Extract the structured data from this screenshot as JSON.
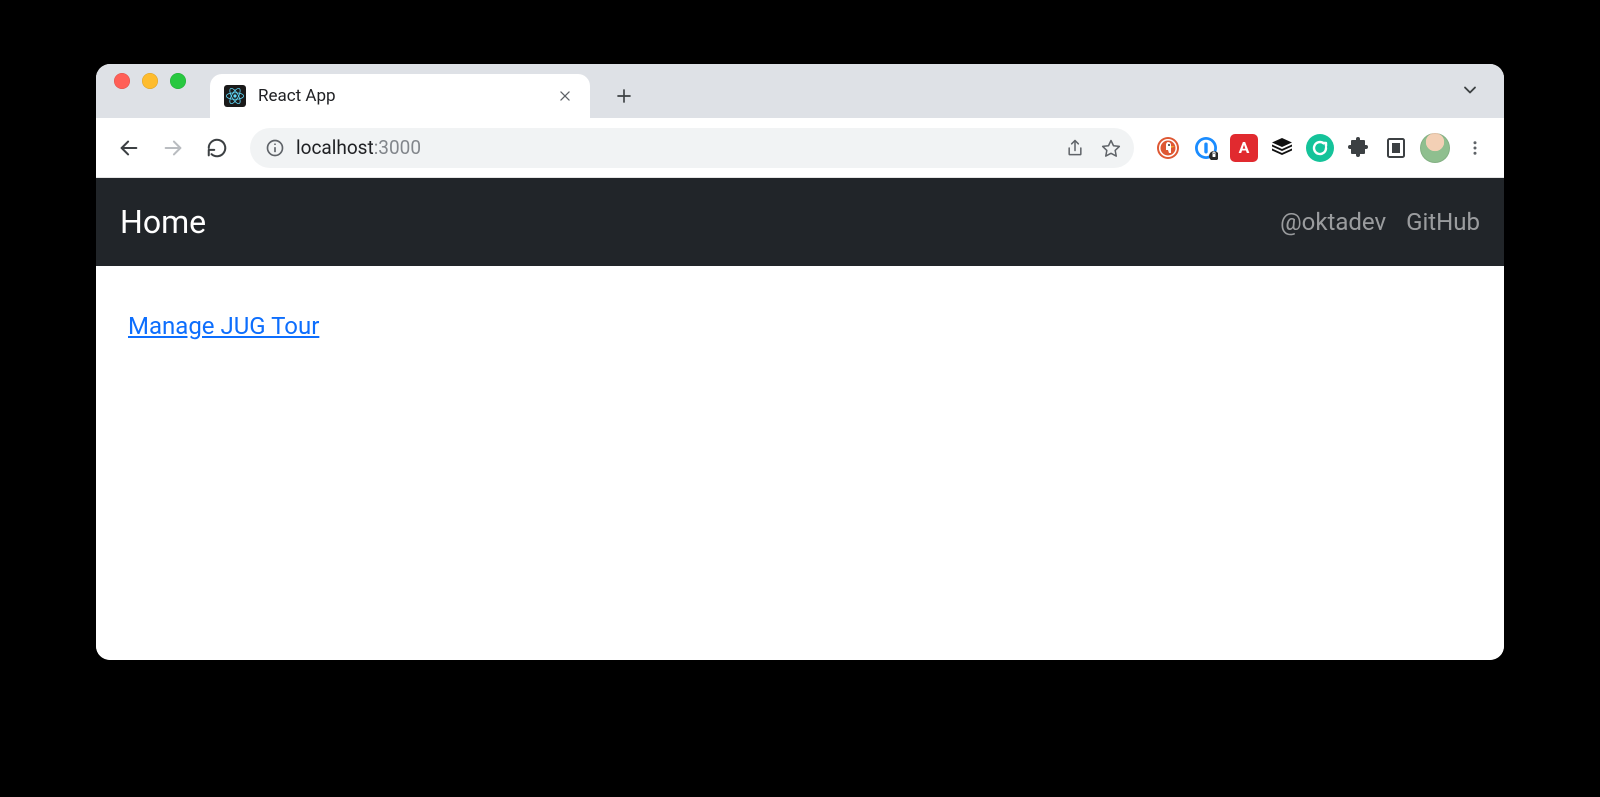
{
  "browser": {
    "tab": {
      "title": "React App",
      "favicon": "react-icon"
    },
    "address": {
      "host": "localhost",
      "port": ":3000"
    },
    "extensions": [
      {
        "name": "duckduckgo-icon"
      },
      {
        "name": "onepassword-icon"
      },
      {
        "name": "asciidoctor-icon",
        "letter": "A"
      },
      {
        "name": "buffer-icon"
      },
      {
        "name": "grammarly-icon"
      },
      {
        "name": "extensions-icon"
      },
      {
        "name": "reader-icon"
      }
    ]
  },
  "app": {
    "brand": "Home",
    "nav": [
      {
        "label": "@oktadev"
      },
      {
        "label": "GitHub"
      }
    ],
    "main_link": "Manage JUG Tour"
  }
}
